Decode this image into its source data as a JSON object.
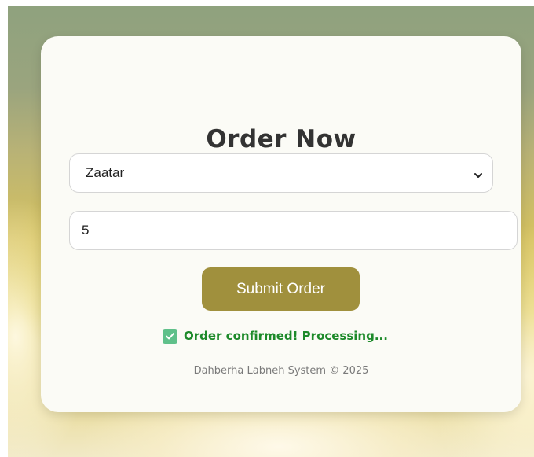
{
  "form": {
    "title": "Order Now",
    "product_select": {
      "selected": "Zaatar"
    },
    "quantity_input": {
      "value": "5"
    },
    "submit_label": "Submit Order",
    "status": {
      "text": "Order confirmed! Processing...",
      "icon": "check-box-icon",
      "color": "#1d8a2a"
    },
    "footer": "Dahberha Labneh System © 2025"
  },
  "colors": {
    "accent": "#a0903d",
    "card": "#fbfbf6",
    "success_icon": "#5fc08a"
  }
}
